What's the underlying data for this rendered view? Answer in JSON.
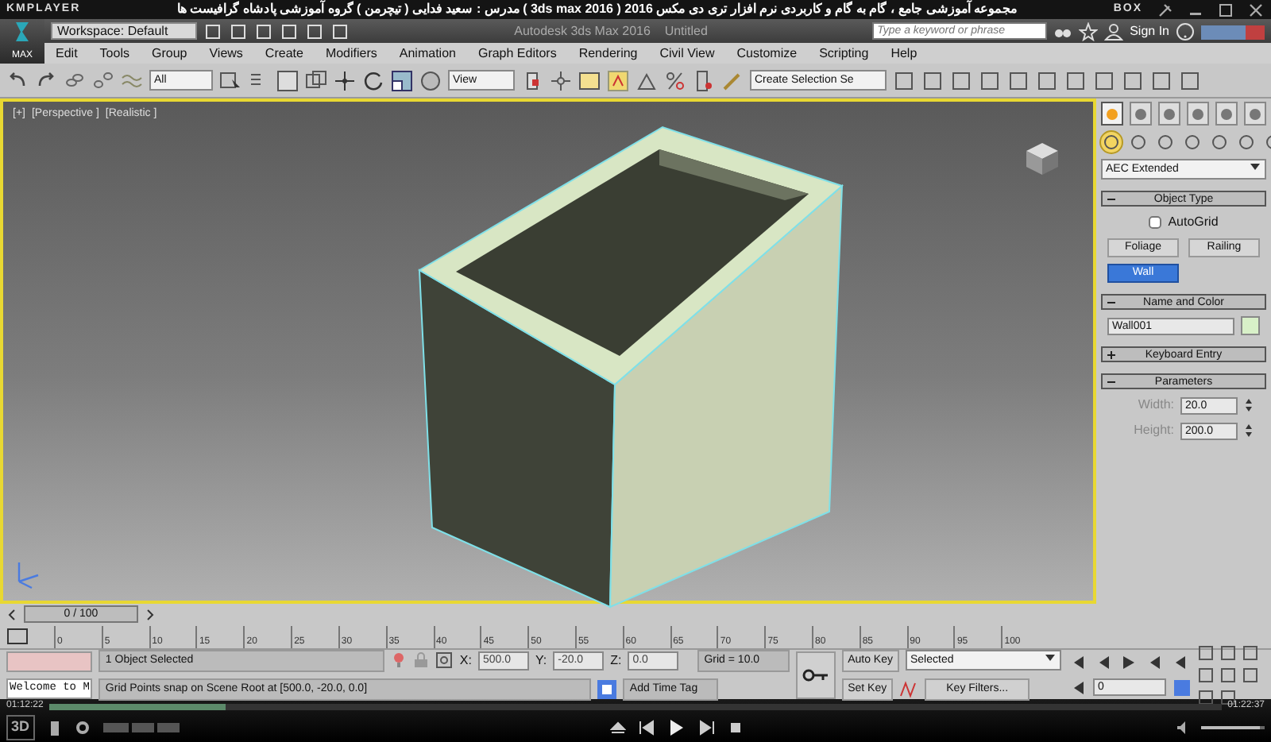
{
  "player": {
    "brand": "KMPLAYER",
    "video_title": "مجموعه آموزشی جامع ، گام به گام و کاربردی نرم افزار تری دی مکس 2016 ( 3ds max 2016 )  مدرس : سعید فدایی ( تیچرمن ) گروه آموزشی پادشاه گرافیست ها",
    "box_label": "BOX",
    "time_elapsed": "01:12:22",
    "time_total": "01:22:37",
    "badge_3d": "3D",
    "progress": {
      "level": 0.15
    },
    "volume": {
      "level": 0.93
    }
  },
  "app": {
    "logo": "MAX",
    "workspace": "Workspace: Default",
    "title": "Autodesk 3ds Max 2016    Untitled",
    "search": {
      "placeholder": "Type a keyword or phrase"
    },
    "sign_in": "Sign In"
  },
  "menu": [
    "Edit",
    "Tools",
    "Group",
    "Views",
    "Create",
    "Modifiers",
    "Animation",
    "Graph Editors",
    "Rendering",
    "Civil View",
    "Customize",
    "Scripting",
    "Help"
  ],
  "toolbar": {
    "selection_filter": "All",
    "reference_coord": "View",
    "named_selection": "Create Selection Se"
  },
  "viewport": {
    "labels": [
      "[+]",
      "[Perspective ]",
      "[Realistic ]"
    ]
  },
  "command_panel": {
    "tabs": [
      {
        "selected": true
      },
      {
        "selected": false
      },
      {
        "selected": false
      },
      {
        "selected": false
      },
      {
        "selected": false
      },
      {
        "selected": false
      }
    ],
    "categories": [
      {
        "selected": true
      },
      {
        "selected": false
      },
      {
        "selected": false
      },
      {
        "selected": false
      },
      {
        "selected": false
      },
      {
        "selected": false
      },
      {
        "selected": false
      }
    ],
    "category_list": "AEC Extended",
    "rollouts": [
      {
        "kind": "object_type",
        "title": "Object Type",
        "expanded": true,
        "autogrid": {
          "label": "AutoGrid",
          "checked": false
        },
        "buttons": [
          {
            "label": "Foliage",
            "selected": false
          },
          {
            "label": "Railing",
            "selected": false
          },
          {
            "label": "Wall",
            "selected": true
          }
        ]
      },
      {
        "kind": "name_color",
        "title": "Name and Color",
        "expanded": true,
        "name": "Wall001"
      },
      {
        "title": "Keyboard Entry",
        "expanded": false
      },
      {
        "kind": "parameters",
        "title": "Parameters",
        "expanded": true,
        "fields": [
          {
            "label": "Width:",
            "value": "20.0"
          },
          {
            "label": "Height:",
            "value": "200.0"
          }
        ]
      }
    ]
  },
  "time_slider": {
    "label": "0 / 100",
    "ticks": [
      "0",
      "5",
      "10",
      "15",
      "20",
      "25",
      "30",
      "35",
      "40",
      "45",
      "50",
      "55",
      "60",
      "65",
      "70",
      "75",
      "80",
      "85",
      "90",
      "95",
      "100"
    ]
  },
  "status": {
    "prompt": "Welcome to M",
    "selection": "1 Object Selected",
    "message": "Grid Points snap on Scene Root at [500.0, -20.0, 0.0]",
    "coords": [
      {
        "label": "X:",
        "value": "500.0"
      },
      {
        "label": "Y:",
        "value": "-20.0"
      },
      {
        "label": "Z:",
        "value": "0.0"
      }
    ],
    "grid": "Grid = 10.0",
    "add_time_tag": "Add Time Tag"
  },
  "animation": {
    "auto_key": "Auto Key",
    "key_mode": "Selected",
    "set_key": "Set Key",
    "key_filters": "Key Filters...",
    "frame": "0"
  }
}
